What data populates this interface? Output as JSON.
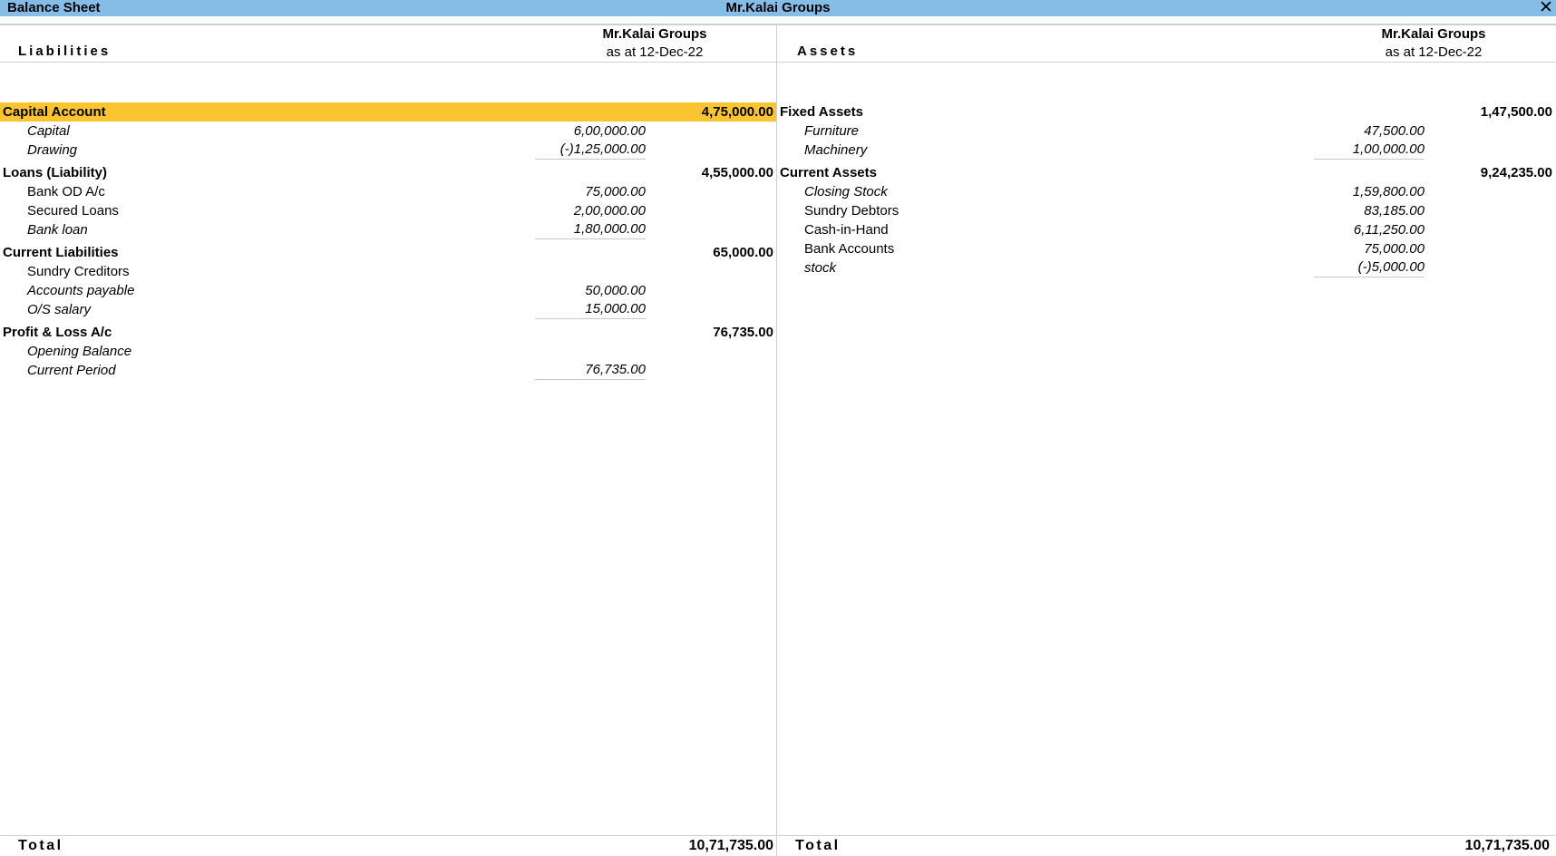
{
  "window": {
    "title": "Balance Sheet",
    "company_title": "Mr.Kalai Groups",
    "close_icon": "close-icon"
  },
  "liabilities": {
    "heading": "Liabilities",
    "company": "Mr.Kalai Groups",
    "period": "as at 12-Dec-22",
    "rows": [
      {
        "type": "group",
        "label": "Capital Account",
        "amount": "4,75,000.00",
        "highlight": true
      },
      {
        "type": "item",
        "label": "Capital",
        "amount": "6,00,000.00",
        "italic": true
      },
      {
        "type": "item",
        "label": "Drawing",
        "amount": "(-)1,25,000.00",
        "italic": true,
        "underline": true
      },
      {
        "type": "group",
        "label": "Loans (Liability)",
        "amount": "4,55,000.00"
      },
      {
        "type": "item",
        "label": "Bank OD A/c",
        "amount": "75,000.00",
        "italic": false
      },
      {
        "type": "item",
        "label": "Secured Loans",
        "amount": "2,00,000.00",
        "italic": false
      },
      {
        "type": "item",
        "label": "Bank loan",
        "amount": "1,80,000.00",
        "italic": true,
        "underline": true
      },
      {
        "type": "group",
        "label": "Current Liabilities",
        "amount": "65,000.00"
      },
      {
        "type": "item",
        "label": "Sundry Creditors",
        "amount": "",
        "italic": false
      },
      {
        "type": "item",
        "label": "Accounts payable",
        "amount": "50,000.00",
        "italic": true
      },
      {
        "type": "item",
        "label": "O/S salary",
        "amount": "15,000.00",
        "italic": true,
        "underline": true
      },
      {
        "type": "group",
        "label": "Profit & Loss A/c",
        "amount": "76,735.00"
      },
      {
        "type": "item",
        "label": "Opening Balance",
        "amount": "",
        "italic": true
      },
      {
        "type": "item",
        "label": "Current Period",
        "amount": "76,735.00",
        "italic": true,
        "underline": true
      }
    ],
    "total_label": "Total",
    "total_amount": "10,71,735.00"
  },
  "assets": {
    "heading": "Assets",
    "company": "Mr.Kalai Groups",
    "period": "as at 12-Dec-22",
    "rows": [
      {
        "type": "group",
        "label": "Fixed Assets",
        "amount": "1,47,500.00"
      },
      {
        "type": "item",
        "label": "Furniture",
        "amount": "47,500.00",
        "italic": true
      },
      {
        "type": "item",
        "label": "Machinery",
        "amount": "1,00,000.00",
        "italic": true,
        "underline": true
      },
      {
        "type": "group",
        "label": "Current Assets",
        "amount": "9,24,235.00"
      },
      {
        "type": "item",
        "label": "Closing Stock",
        "amount": "1,59,800.00",
        "italic": true
      },
      {
        "type": "item",
        "label": "Sundry Debtors",
        "amount": "83,185.00",
        "italic": false
      },
      {
        "type": "item",
        "label": "Cash-in-Hand",
        "amount": "6,11,250.00",
        "italic": false
      },
      {
        "type": "item",
        "label": "Bank Accounts",
        "amount": "75,000.00",
        "italic": false
      },
      {
        "type": "item",
        "label": "stock",
        "amount": "(-)5,000.00",
        "italic": true,
        "underline": true
      }
    ],
    "total_label": "Total",
    "total_amount": "10,71,735.00"
  },
  "colors": {
    "titlebar": "#86bde6",
    "highlight": "#fbc531",
    "rule": "#cfcfcf"
  }
}
